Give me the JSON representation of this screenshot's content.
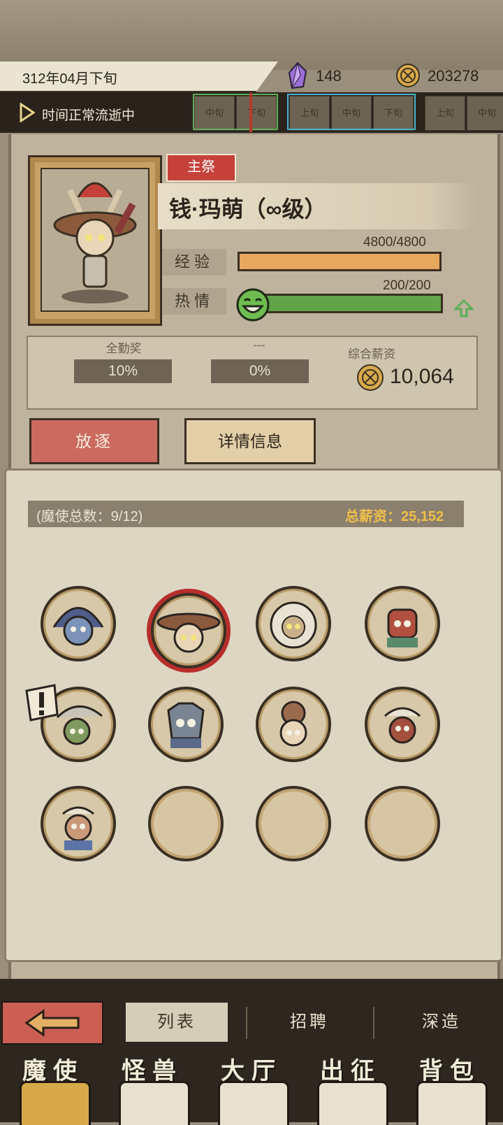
{
  "header": {
    "date": "312年04月下旬",
    "crystal_count": "148",
    "coin_count": "203278"
  },
  "time_bar": {
    "status": "时间正常流逝中",
    "periods": [
      "中旬",
      "下旬",
      "上旬",
      "中旬",
      "下旬",
      "上旬",
      "中旬"
    ]
  },
  "character": {
    "role_badge": "主祭",
    "name": "钱·玛萌（∞级）",
    "exp_label": "经验",
    "exp_value": "4800/4800",
    "exp_progress": 1.0,
    "passion_label": "热情",
    "passion_value": "200/200",
    "passion_progress": 1.0
  },
  "bonuses": {
    "attendance_title": "全勤奖",
    "attendance_value": "10%",
    "other_title": "---",
    "other_value": "0%",
    "salary_title": "综合薪资",
    "salary_value": "10,064"
  },
  "actions": {
    "exile_label": "放逐",
    "details_label": "详情信息"
  },
  "roster": {
    "count_text": "(魔使总数：9/12)",
    "total_salary_text": "总薪资：25,152",
    "slots_filled": 9,
    "slots_total": 12
  },
  "subtabs": {
    "list": "列表",
    "recruit": "招聘",
    "forge": "深造"
  },
  "nav": {
    "demon": "魔使",
    "monster": "怪兽",
    "hall": "大厅",
    "expedition": "出征",
    "bag": "背包"
  },
  "colors": {
    "exp_bar": "#e7a75c",
    "passion_bar": "#62a44a",
    "accent_red": "#c5413a",
    "gold_text": "#f0c04a"
  }
}
